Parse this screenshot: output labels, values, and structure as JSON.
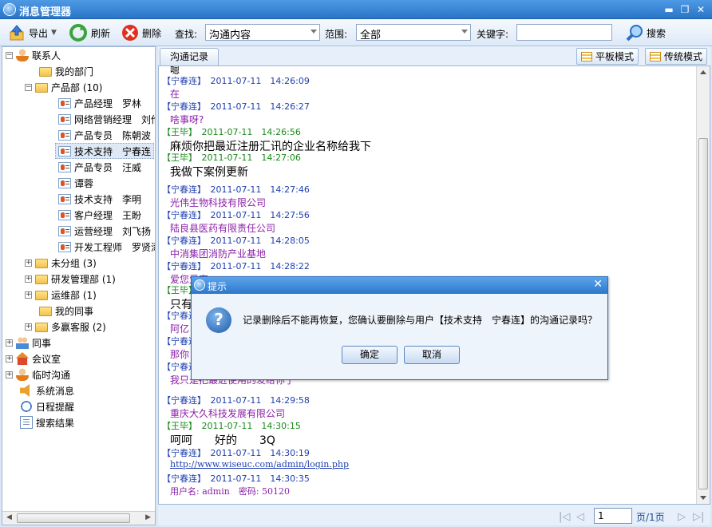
{
  "window": {
    "title": "消息管理器",
    "minimize": "▬",
    "restore": "❐",
    "close": "✕"
  },
  "toolbar": {
    "export_label": "导出",
    "refresh_label": "刷新",
    "delete_label": "删除",
    "find_label": "查找:",
    "find_value": "沟通内容",
    "scope_label": "范围:",
    "scope_value": "全部",
    "keyword_label": "关键字:",
    "keyword_value": "",
    "search_label": "搜索"
  },
  "tree": {
    "contacts": "联系人",
    "my_dept": "我的部门",
    "product_dept": "产品部 (10)",
    "members": [
      {
        "label": "产品经理　罗林"
      },
      {
        "label": "网络营销经理　刘伦"
      },
      {
        "label": "产品专员　陈朝波"
      },
      {
        "label": "技术支持　宁春连"
      },
      {
        "label": "产品专员　汪威"
      },
      {
        "label": "谭蓉"
      },
      {
        "label": "技术支持　李明"
      },
      {
        "label": "客户经理　王盼"
      },
      {
        "label": "运营经理　刘飞扬"
      },
      {
        "label": "开发工程师　罗贤添"
      }
    ],
    "ungrouped": "未分组 (3)",
    "rd_dept": "研发管理部 (1)",
    "ops_dept": "运维部 (1)",
    "my_colleagues": "我的同事",
    "service": "多赢客服 (2)",
    "colleagues": "同事",
    "meeting": "会议室",
    "temp_chat": "临时沟通",
    "system_msg": "系统消息",
    "schedule": "日程提醒",
    "search_results": "搜索结果"
  },
  "right": {
    "tab_label": "沟通记录",
    "flat_mode": "平板模式",
    "classic_mode": "传统模式"
  },
  "messages": [
    {
      "head": "",
      "body": "嗯"
    },
    {
      "head": "【宁春连】　2011-07-11　14:26:09",
      "body": "在"
    },
    {
      "head": "【宁春连】　2011-07-11　14:26:27",
      "body": "啥事呀?"
    },
    {
      "head": "【王毕】　2011-07-11　14:26:56",
      "body": "麻烦你把最近注册汇讯的企业名称给我下"
    },
    {
      "head": "【王毕】　2011-07-11　14:27:06",
      "body": "我做下案例更新"
    },
    {
      "head": "【宁春连】　2011-07-11　14:27:46",
      "body": "光伟生物科技有限公司"
    },
    {
      "head": "【宁春连】　2011-07-11　14:27:56",
      "body": "陆良县医药有限责任公司"
    },
    {
      "head": "【宁春连】　2011-07-11　14:28:05",
      "body": "中消集团消防产业基地"
    },
    {
      "head": "【宁春连】　2011-07-11　14:28:22",
      "body": "爱您爱家"
    },
    {
      "head": "【王毕】",
      "body": "只有"
    },
    {
      "head": "【宁春连】",
      "body": "阿亿"
    },
    {
      "head": "【宁春连】",
      "body": "那你"
    },
    {
      "head": "【宁春连】",
      "body": "我只是把最近使用的发给你了"
    },
    {
      "head": "【宁春连】　2011-07-11　14:29:58",
      "body": "重庆大久科技发展有限公司"
    },
    {
      "head": "【王毕】　2011-07-11　14:30:15",
      "body": "呵呵　　好的　　3Q"
    },
    {
      "head": "【宁春连】　2011-07-11　14:30:19",
      "body": "http://www.wiseuc.com/admin/login.php"
    },
    {
      "head": "【宁春连】　2011-07-11　14:30:35",
      "body": "用户名: admin　密码: 50120"
    }
  ],
  "pager": {
    "page_value": "1",
    "page_label": "页/1页"
  },
  "dialog": {
    "title": "提示",
    "close": "✕",
    "icon": "?",
    "message": "记录删除后不能再恢复，您确认要删除与用户【技术支持　宁春连】的沟通记录吗？",
    "ok": "确定",
    "cancel": "取消"
  },
  "colors": {
    "blue_name": "#1f3fb0",
    "green_name": "#1a8a1a",
    "purple_text": "#8a1fa8"
  }
}
